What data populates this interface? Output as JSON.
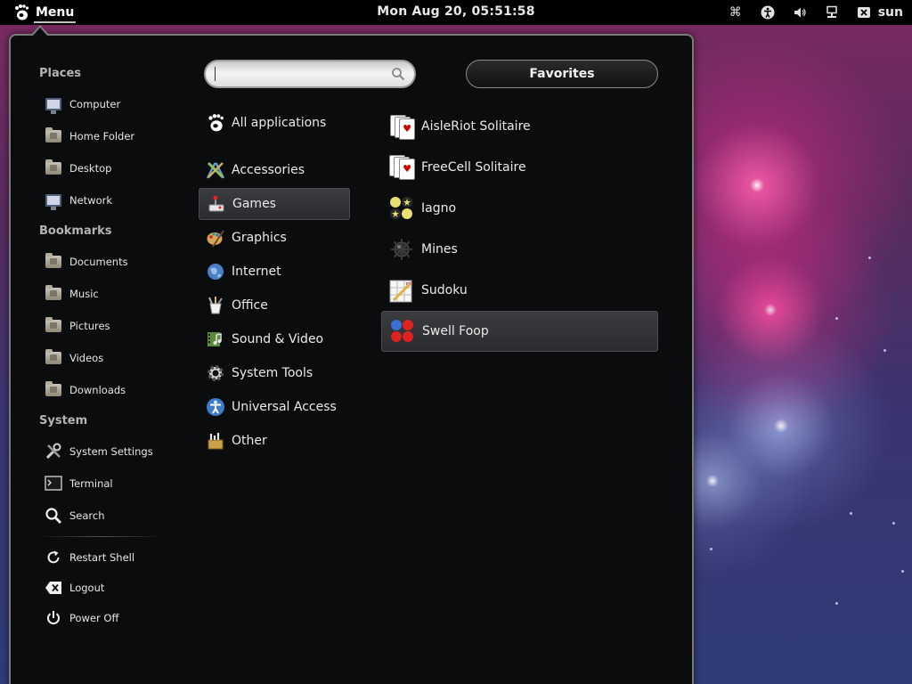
{
  "topbar": {
    "menu_label": "Menu",
    "clock": "Mon Aug 20, 05:51:58",
    "user": "sun",
    "status_icons": [
      "keyboard-icon",
      "accessibility-icon",
      "volume-icon",
      "network-icon",
      "user-offline-icon"
    ]
  },
  "places": {
    "title": "Places",
    "items": [
      {
        "label": "Computer",
        "icon": "computer-icon"
      },
      {
        "label": "Home Folder",
        "icon": "home-folder-icon"
      },
      {
        "label": "Desktop",
        "icon": "desktop-folder-icon"
      },
      {
        "label": "Network",
        "icon": "network-icon"
      }
    ]
  },
  "bookmarks": {
    "title": "Bookmarks",
    "items": [
      {
        "label": "Documents",
        "icon": "documents-folder-icon"
      },
      {
        "label": "Music",
        "icon": "music-folder-icon"
      },
      {
        "label": "Pictures",
        "icon": "pictures-folder-icon"
      },
      {
        "label": "Videos",
        "icon": "videos-folder-icon"
      },
      {
        "label": "Downloads",
        "icon": "downloads-folder-icon"
      }
    ]
  },
  "system": {
    "title": "System",
    "items": [
      {
        "label": "System Settings",
        "icon": "settings-icon"
      },
      {
        "label": "Terminal",
        "icon": "terminal-icon"
      },
      {
        "label": "Search",
        "icon": "search-icon"
      }
    ]
  },
  "session": {
    "items": [
      {
        "label": "Restart Shell",
        "icon": "restart-icon"
      },
      {
        "label": "Logout",
        "icon": "logout-icon"
      },
      {
        "label": "Power Off",
        "icon": "power-icon"
      }
    ]
  },
  "search": {
    "value": "",
    "placeholder": ""
  },
  "favorites_label": "Favorites",
  "categories": {
    "selected": "Games",
    "items": [
      {
        "label": "All applications",
        "icon": "gnome-foot-icon"
      },
      {
        "label": "Accessories",
        "icon": "accessories-icon"
      },
      {
        "label": "Games",
        "icon": "games-icon"
      },
      {
        "label": "Graphics",
        "icon": "graphics-icon"
      },
      {
        "label": "Internet",
        "icon": "internet-icon"
      },
      {
        "label": "Office",
        "icon": "office-icon"
      },
      {
        "label": "Sound & Video",
        "icon": "sound-video-icon"
      },
      {
        "label": "System Tools",
        "icon": "system-tools-icon"
      },
      {
        "label": "Universal Access",
        "icon": "universal-access-icon"
      },
      {
        "label": "Other",
        "icon": "other-icon"
      }
    ]
  },
  "apps": {
    "selected": "Swell Foop",
    "items": [
      {
        "label": "AisleRiot Solitaire",
        "icon": "aisleriot-icon"
      },
      {
        "label": "FreeCell Solitaire",
        "icon": "freecell-icon"
      },
      {
        "label": "Iagno",
        "icon": "iagno-icon"
      },
      {
        "label": "Mines",
        "icon": "mines-icon"
      },
      {
        "label": "Sudoku",
        "icon": "sudoku-icon"
      },
      {
        "label": "Swell Foop",
        "icon": "swell-foop-icon"
      }
    ]
  },
  "colors": {
    "panel_bg": "#0b0c0e",
    "topbar_bg": "#000000",
    "selection_bg": "#34363a",
    "text": "#eaeaea"
  }
}
